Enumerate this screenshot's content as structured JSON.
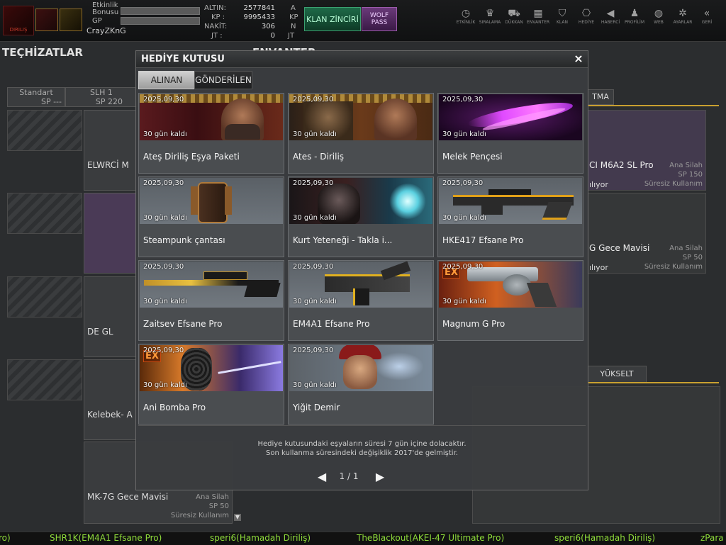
{
  "header": {
    "logo_text": "DIRILIŞ",
    "stats": [
      {
        "label": "Etkinlik Bonusu"
      },
      {
        "label": "GP"
      }
    ],
    "username": "CrayZKnG",
    "currency": [
      {
        "label": "ALTIN:",
        "value": "2577841",
        "unit": "A"
      },
      {
        "label": "KP :",
        "value": "9995433",
        "unit": "KP"
      },
      {
        "label": "NAKİT:",
        "value": "306",
        "unit": "N"
      },
      {
        "label": "JT :",
        "value": "0",
        "unit": "JT"
      }
    ],
    "klan_button": "KLAN ZİNCİRİ",
    "wolf_button": "WOLF PASS",
    "nav": [
      {
        "icon": "clock-icon",
        "glyph": "◷",
        "label": "ETKİNLİK"
      },
      {
        "icon": "ranking-icon",
        "glyph": "♛",
        "label": "SIRALAMA"
      },
      {
        "icon": "cart-icon",
        "glyph": "⛟",
        "label": "DÜKKAN"
      },
      {
        "icon": "inventory-icon",
        "glyph": "▦",
        "label": "ENVANTER"
      },
      {
        "icon": "clan-icon",
        "glyph": "⛉",
        "label": "KLAN"
      },
      {
        "icon": "gift-icon",
        "glyph": "⎔",
        "label": "HEDİYE"
      },
      {
        "icon": "megaphone-icon",
        "glyph": "◀",
        "label": "HABERCİ"
      },
      {
        "icon": "profile-icon",
        "glyph": "♟",
        "label": "PROFİLİM"
      },
      {
        "icon": "globe-icon",
        "glyph": "◍",
        "label": "WEB"
      },
      {
        "icon": "gear-icon",
        "glyph": "✲",
        "label": "AYARLAR"
      },
      {
        "icon": "back-icon",
        "glyph": "«",
        "label": "GERİ"
      }
    ]
  },
  "background": {
    "left_title": "TEÇHİZATLAR",
    "center_title": "ENVANTER",
    "tabs": [
      {
        "label": "Standart",
        "sub": "SP ---"
      },
      {
        "label": "SLH 1",
        "sub": "SP 220"
      }
    ],
    "left_cards": [
      {
        "label": "ELWRCİ M"
      },
      {
        "label": "DE GL"
      },
      {
        "label": "Kelebek- A"
      },
      {
        "label": "MK-7G Gece Mavisi",
        "type": "Ana Silah",
        "sp": "SP 50",
        "duration": "Süresiz Kullanım"
      }
    ],
    "right_tab": "TMA",
    "right_cards": [
      {
        "label": "CI M6A2 SL Pro",
        "type": "Ana Silah",
        "sp": "SP 150",
        "status": "ılıyor",
        "duration": "Süresiz Kullanım"
      },
      {
        "label": "G Gece Mavisi",
        "type": "Ana Silah",
        "sp": "SP 50",
        "status": "ılıyor",
        "duration": "Süresiz Kullanım"
      }
    ],
    "upgrade_button": "YÜKSELT"
  },
  "modal": {
    "title": "HEDİYE KUTUSU",
    "tabs": {
      "received": "ALINAN",
      "sent": "GÖNDERİLEN"
    },
    "items": [
      {
        "date": "2025,09,30",
        "days": "30 gün kaldı",
        "name": "Ateş Diriliş Eşya Paketi",
        "theme": "warrior"
      },
      {
        "date": "2025,09,30",
        "days": "30 gün kaldı",
        "name": "Ates - Diriliş",
        "theme": "warrior2"
      },
      {
        "date": "2025,09,30",
        "days": "30 gün kaldı",
        "name": "Melek Pençesi",
        "theme": "claw"
      },
      {
        "date": "2025,09,30",
        "days": "30 gün kaldı",
        "name": "Steampunk çantası",
        "theme": "bag"
      },
      {
        "date": "2025,09,30",
        "days": "30 gün kaldı",
        "name": "Kurt Yeteneği - Takla i...",
        "theme": "wolf"
      },
      {
        "date": "2025,09,30",
        "days": "30 gün kaldı",
        "name": "HKE417 Efsane Pro",
        "theme": "rifle"
      },
      {
        "date": "2025,09,30",
        "days": "30 gün kaldı",
        "name": "Zaitsev Efsane Pro",
        "theme": "sniper"
      },
      {
        "date": "2025,09,30",
        "days": "30 gün kaldı",
        "name": "EM4A1 Efsane Pro",
        "theme": "smg"
      },
      {
        "date": "2025,09,30",
        "days": "30 gün kaldı",
        "name": "Magnum G Pro",
        "theme": "revolver",
        "badge": "EX"
      },
      {
        "date": "2025,09,30",
        "days": "30 gün kaldı",
        "name": "Ani Bomba Pro",
        "theme": "bomb",
        "badge": "EX"
      },
      {
        "date": "2025,09,30",
        "days": "30 gün kaldı",
        "name": "Yiğit Demir",
        "theme": "soldier"
      }
    ],
    "notice_line1": "Hediye kutusundaki eşyaların süresi 7 gün içine dolacaktır.",
    "notice_line2": "Son kullanma süresindeki değişiklik 2017'de gelmiştir.",
    "page": "1 / 1",
    "prev": "◀",
    "next": "▶",
    "close": "×"
  },
  "ticker": [
    "ro)",
    "SHR1K(EM4A1 Efsane Pro)",
    "speri6(Hamadah Diriliş)",
    "TheBlackout(AKEI-47 Ultimate Pro)",
    "speri6(Hamadah Diriliş)",
    "zPara"
  ]
}
